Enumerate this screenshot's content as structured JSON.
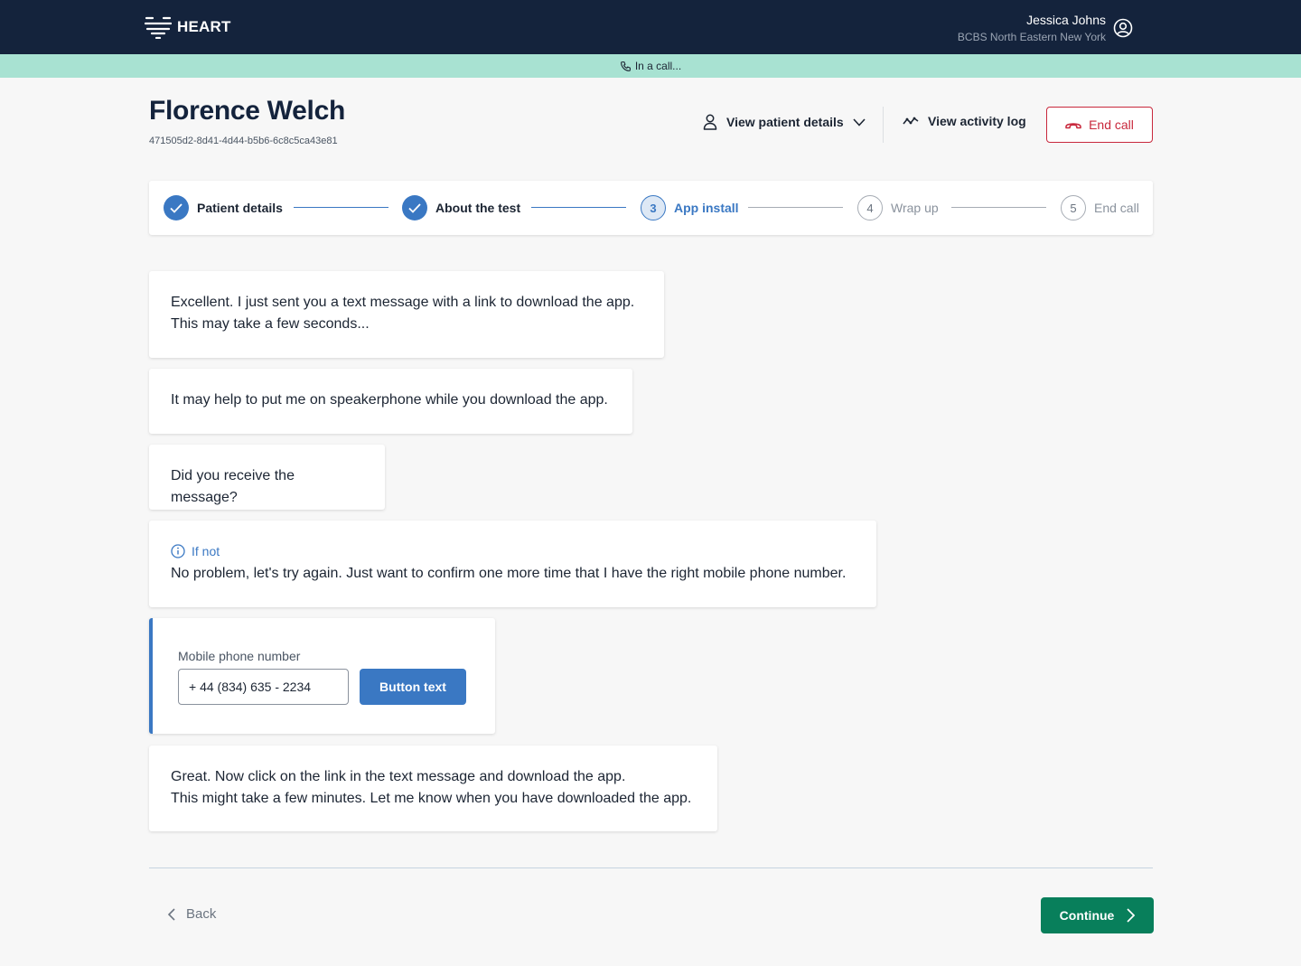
{
  "app": {
    "logo_text": "HEART",
    "user_name": "Jessica Johns",
    "user_org": "BCBS North Eastern New York"
  },
  "call_banner": {
    "text": "In a call..."
  },
  "patient": {
    "name": "Florence Welch",
    "id": "471505d2-8d41-4d44-b5b6-6c8c5ca43e81"
  },
  "header_actions": {
    "view_patient_details": "View patient details",
    "view_activity_log": "View activity log",
    "end_call": "End call"
  },
  "steps": [
    {
      "number": "1",
      "label": "Patient details",
      "state": "done"
    },
    {
      "number": "2",
      "label": "About the test",
      "state": "done"
    },
    {
      "number": "3",
      "label": "App install",
      "state": "active"
    },
    {
      "number": "4",
      "label": "Wrap up",
      "state": "todo"
    },
    {
      "number": "5",
      "label": "End call",
      "state": "todo"
    }
  ],
  "script": {
    "msg1_line1": "Excellent. I just sent you a text message with a link to download the app.",
    "msg1_line2": "This may take a few seconds...",
    "msg2": "It may help to put me on speakerphone while you download the app.",
    "msg3": "Did you receive the message?",
    "msg4_heading": "If not",
    "msg4": "No problem, let's try again. Just want to confirm one more time that I have the right mobile phone number.",
    "msg5_line1": "Great. Now click on the link in the text message and download the app.",
    "msg5_line2": "This might take a few minutes. Let me know when you have downloaded the app."
  },
  "phone_form": {
    "label": "Mobile phone number",
    "value": "+ 44 (834) 635 - 2234",
    "button": "Button text"
  },
  "footer": {
    "back": "Back",
    "continue": "Continue"
  },
  "colors": {
    "navy": "#14233c",
    "banner": "#a8e2d2",
    "primary_blue": "#3a78c3",
    "danger": "#c8283c",
    "success": "#087f5b"
  }
}
